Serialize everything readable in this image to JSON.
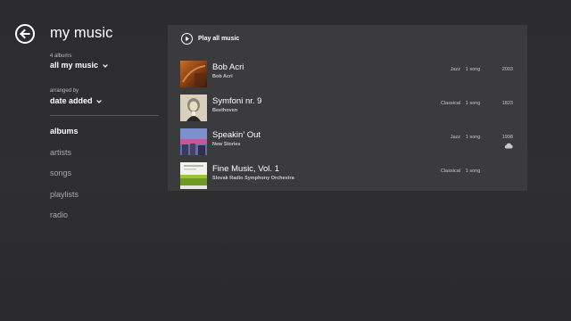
{
  "header": {
    "title": "my music",
    "back_icon": "back-arrow-icon"
  },
  "filters": {
    "count_caption": "4 albums",
    "source_label": "all my music",
    "arranged_caption": "arranged by",
    "sort_label": "date added"
  },
  "nav": {
    "items": [
      {
        "label": "albums",
        "active": true
      },
      {
        "label": "artists",
        "active": false
      },
      {
        "label": "songs",
        "active": false
      },
      {
        "label": "playlists",
        "active": false
      },
      {
        "label": "radio",
        "active": false
      }
    ]
  },
  "panel": {
    "play_all_label": "Play all music",
    "albums": [
      {
        "title": "Bob Acri",
        "artist": "Bob Acri",
        "genre": "Jazz",
        "count": "1 song",
        "year": "2003",
        "cloud": false
      },
      {
        "title": "Symfoni nr. 9",
        "artist": "Beethoven",
        "genre": "Classical",
        "count": "1 song",
        "year": "1823",
        "cloud": false
      },
      {
        "title": "Speakin’ Out",
        "artist": "New Stories",
        "genre": "Jazz",
        "count": "1 song",
        "year": "1998",
        "cloud": true
      },
      {
        "title": "Fine Music, Vol. 1",
        "artist": "Slovak Radio Symphony Orchestra",
        "genre": "Classical",
        "count": "1 song",
        "year": "",
        "cloud": false
      }
    ]
  },
  "colors": {
    "background": "#2c2c2e",
    "panel": "#3b3b3e",
    "text_primary": "#ffffff",
    "text_secondary": "#a9a9ab"
  }
}
